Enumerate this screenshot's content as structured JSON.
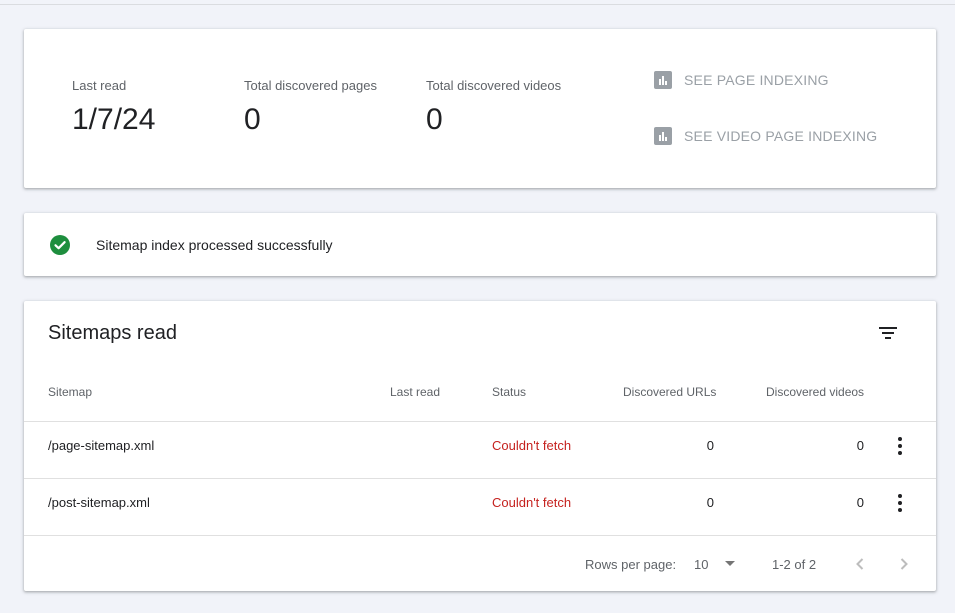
{
  "stats": {
    "last_read_label": "Last read",
    "last_read_value": "1/7/24",
    "pages_label": "Total discovered pages",
    "pages_value": "0",
    "videos_label": "Total discovered videos",
    "videos_value": "0",
    "links": [
      {
        "label": "SEE PAGE INDEXING",
        "icon": "bar-chart-icon"
      },
      {
        "label": "SEE VIDEO PAGE INDEXING",
        "icon": "bar-chart-icon"
      }
    ]
  },
  "status": {
    "message": "Sitemap index processed successfully",
    "icon": "check-circle-icon",
    "color": "#1e8e3e"
  },
  "table": {
    "title": "Sitemaps read",
    "columns": [
      "Sitemap",
      "Last read",
      "Status",
      "Discovered URLs",
      "Discovered videos"
    ],
    "rows": [
      {
        "sitemap": "/page-sitemap.xml",
        "last_read": "",
        "status": "Couldn't fetch",
        "urls": "0",
        "videos": "0"
      },
      {
        "sitemap": "/post-sitemap.xml",
        "last_read": "",
        "status": "Couldn't fetch",
        "urls": "0",
        "videos": "0"
      }
    ],
    "footer": {
      "rows_per_page_label": "Rows per page:",
      "rows_per_page_value": "10",
      "range": "1-2 of 2"
    }
  },
  "colors": {
    "error": "#c5221f",
    "muted": "#9aa0a6",
    "success": "#1e8e3e"
  }
}
